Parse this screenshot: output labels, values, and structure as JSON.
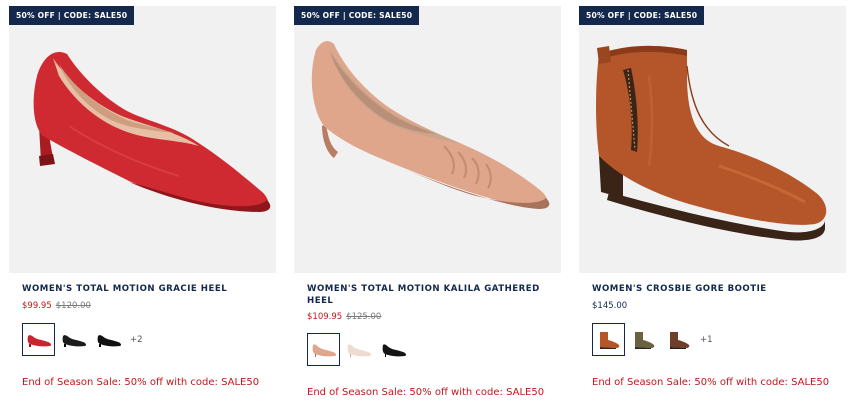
{
  "products": [
    {
      "badge": "50% OFF | CODE: SALE50",
      "name": "WOMEN'S TOTAL MOTION GRACIE HEEL",
      "sale_price": "$99.95",
      "original_price": "$120.00",
      "swatch_more": "+2",
      "promo": "End of Season Sale: 50% off with code: SALE50",
      "color": "#c8262e"
    },
    {
      "badge": "50% OFF | CODE: SALE50",
      "name": "WOMEN'S TOTAL MOTION KALILA GATHERED HEEL",
      "sale_price": "$109.95",
      "original_price": "$125.00",
      "promo": "End of Season Sale: 50% off with code: SALE50",
      "color": "#e1a88e"
    },
    {
      "badge": "50% OFF | CODE: SALE50",
      "name": "WOMEN'S CROSBIE GORE BOOTIE",
      "price": "$145.00",
      "swatch_more": "+1",
      "promo": "End of Season Sale: 50% off with code: SALE50",
      "color": "#b5562a"
    }
  ],
  "colors": {
    "navy": "#13284c",
    "sale_red": "#c4161c",
    "image_bg": "#f1f1f1"
  }
}
